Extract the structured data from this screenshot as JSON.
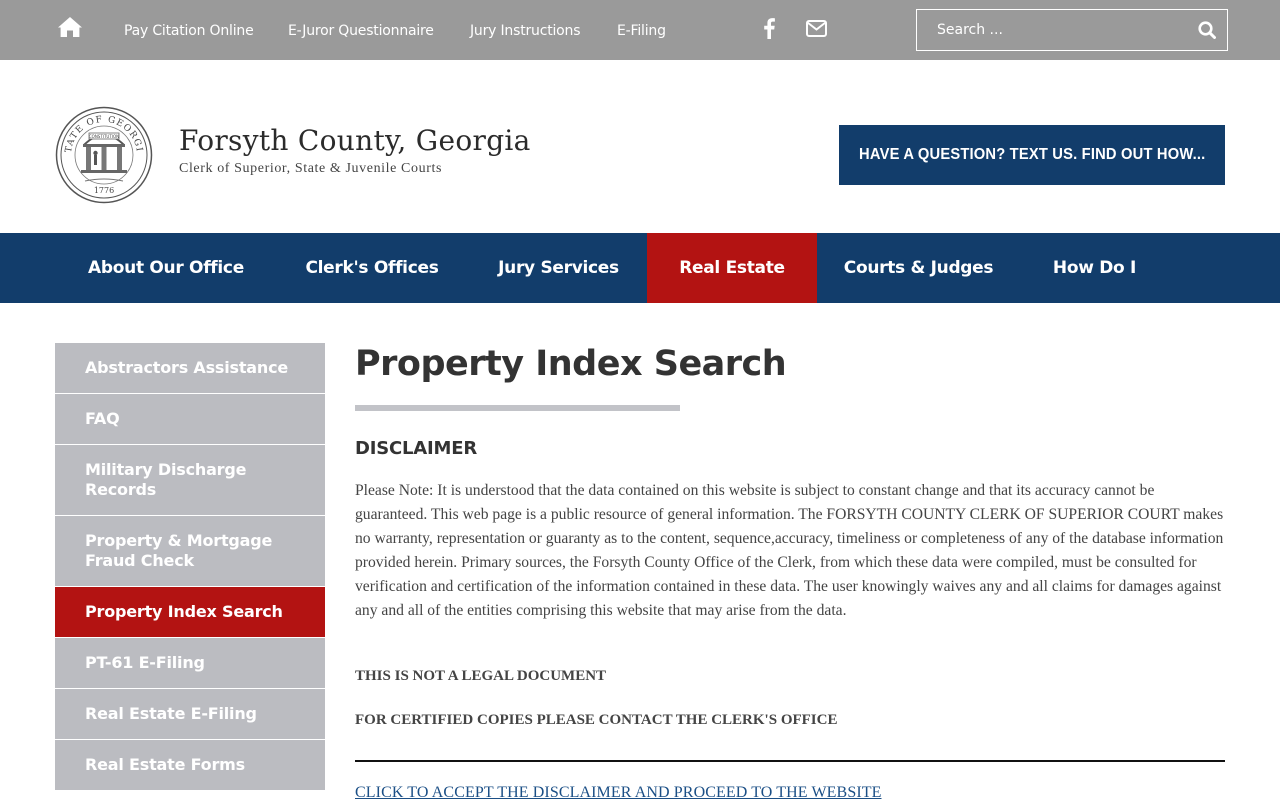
{
  "topbar": {
    "home_icon": "home-icon",
    "links": [
      "Pay Citation Online",
      "E-Juror Questionnaire",
      "Jury Instructions",
      "E-Filing"
    ],
    "social_icons": [
      "facebook-icon",
      "mail-icon"
    ],
    "search": {
      "placeholder": "Search ...",
      "value": "",
      "icon": "search-icon"
    }
  },
  "header": {
    "seal": {
      "ring_text": "STATE OF GEORGIA",
      "band_text": "CONSTITUTION",
      "year": "1776",
      "icon": "state-seal-icon"
    },
    "title": "Forsyth County, Georgia",
    "subtitle": "Clerk of Superior, State & Juvenile Courts",
    "cta_label": "HAVE A QUESTION? TEXT US. FIND OUT HOW..."
  },
  "nav": {
    "items": [
      "About Our Office",
      "Clerk's Offices",
      "Jury Services",
      "Real Estate",
      "Courts & Judges",
      "How Do I"
    ],
    "active": "Real Estate"
  },
  "sidebar": {
    "items": [
      "Abstractors Assistance",
      "FAQ",
      "Military Discharge Records",
      "Property & Mortgage Fraud Check",
      "Property Index Search",
      "PT-61 E-Filing",
      "Real Estate E-Filing",
      "Real Estate Forms"
    ],
    "active": "Property Index Search"
  },
  "content": {
    "title": "Property Index Search",
    "disclaimer_heading": "DISCLAIMER",
    "disclaimer_text": "Please Note: It is understood that the data contained on this website is subject to constant change and that its accuracy cannot be guaranteed. This web page is a public resource of general information. The FORSYTH COUNTY CLERK OF SUPERIOR COURT makes no warranty, representation or guaranty as to the content, sequence,accuracy, timeliness or completeness of any of the database information provided herein. Primary sources, the Forsyth County Office of the Clerk, from which these data were compiled, must be consulted for verification and certification of the information contained in these data. The user knowingly waives any and all claims for damages against any and all of the entities comprising this website that may arise from the data.",
    "legal_note": "THIS IS NOT A LEGAL DOCUMENT",
    "copies_note": "FOR CERTIFIED COPIES PLEASE CONTACT THE CLERK'S OFFICE",
    "accept_link": "CLICK TO ACCEPT THE DISCLAIMER AND PROCEED TO THE WEBSITE"
  },
  "colors": {
    "topbar": "#9a9a9a",
    "navy": "#123d6b",
    "active_red": "#b31312",
    "sidebar_gray": "#bbbcc1",
    "link_blue": "#1b4f86"
  }
}
